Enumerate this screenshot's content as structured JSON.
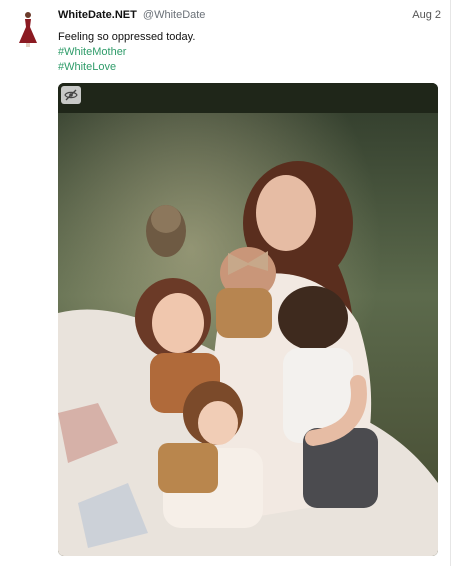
{
  "post": {
    "display_name": "WhiteDate.NET",
    "handle": "@WhiteDate",
    "date": "Aug 2",
    "text": "Feeling so oppressed today.",
    "hashtags": [
      "#WhiteMother",
      "#WhiteLove"
    ]
  },
  "media": {
    "hide_icon": "eye-slash-icon"
  },
  "colors": {
    "hashtag": "#2f9c6a",
    "handle": "#6b7178",
    "avatar_dress": "#8b1a22"
  }
}
